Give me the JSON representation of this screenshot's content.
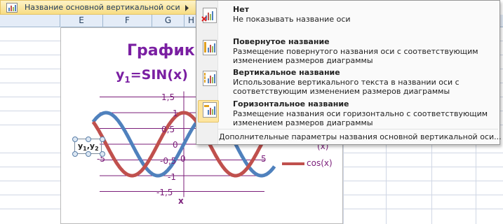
{
  "menu": {
    "title": "Название основной вертикальной оси",
    "icon": "axis-title-icon",
    "arrow": "submenu-arrow-icon"
  },
  "columns": [
    "E",
    "F",
    "G",
    "H"
  ],
  "chart": {
    "title_line1": "Графики",
    "title_line2_main": "y",
    "title_line2_sub": "1",
    "title_line2_rest": "=SIN(x)",
    "ylabel_main": "y",
    "ylabel_sub1": "1",
    "ylabel_sep": ",y",
    "ylabel_sub2": "2",
    "xlabel": "x",
    "y_ticks": [
      "1,5",
      "1",
      "0,5",
      "0",
      "-0,5",
      "-1",
      "-1,5"
    ],
    "x_ticks": [
      "-5",
      "0",
      "5"
    ],
    "legend_cos": "cos(x)",
    "legend_hidden_paren": "(x)",
    "sin_color": "#4f81bd",
    "cos_color": "#c0504d"
  },
  "chart_data": {
    "type": "line",
    "x_range": [
      -5.5,
      5.5
    ],
    "ylim": [
      -1.5,
      1.5
    ],
    "series": [
      {
        "name": "sin(x)",
        "function": "sin"
      },
      {
        "name": "cos(x)",
        "function": "cos"
      }
    ]
  },
  "dropdown": {
    "options": [
      {
        "title": "Нет",
        "desc": "Не показывать название оси",
        "icon": "no-axis-title-icon"
      },
      {
        "title": "Повернутое название",
        "desc": "Размещение повернутого названия оси с соответствующим изменением размеров диаграммы",
        "icon": "rotated-title-icon"
      },
      {
        "title": "Вертикальное название",
        "desc": "Использование вертикального текста в названии оси с соответствующим изменением размеров диаграммы",
        "icon": "vertical-title-icon"
      },
      {
        "title": "Горизонтальное название",
        "desc": "Размещение названия оси горизонтально с соответствующим изменением размеров диаграммы",
        "icon": "horizontal-title-icon"
      }
    ],
    "more": "Дополнительные параметры названия основной вертикальной оси..."
  }
}
